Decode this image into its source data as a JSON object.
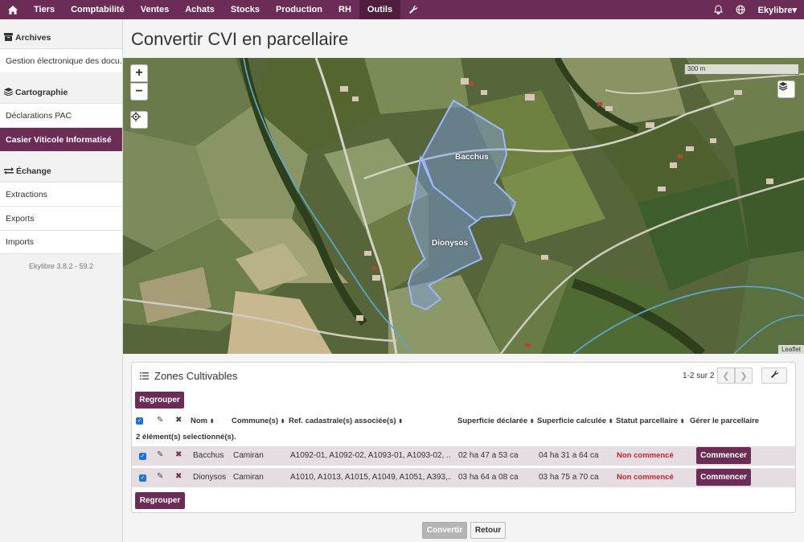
{
  "topbar": {
    "home_icon": "home-icon",
    "items": [
      "Tiers",
      "Comptabilité",
      "Ventes",
      "Achats",
      "Stocks",
      "Production",
      "RH",
      "Outils"
    ],
    "active": "Outils",
    "wrench_icon": "wrench-icon",
    "bell_icon": "bell-icon",
    "globe_icon": "globe-icon",
    "user_label": "Ekylibre▾"
  },
  "sidebar": {
    "sections": [
      {
        "title": "Archives",
        "icon": "archive-icon",
        "items": [
          "Gestion électronique des docu..."
        ]
      },
      {
        "title": "Cartographie",
        "icon": "layers-icon",
        "items": [
          "Déclarations PAC",
          "Casier Viticole Informatisé"
        ]
      },
      {
        "title": "Échange",
        "icon": "exchange-icon",
        "items": [
          "Extractions",
          "Exports",
          "Imports"
        ]
      }
    ],
    "active_item": "Casier Viticole Informatisé",
    "version": "Ekylibre 3.8.2 - 59.2"
  },
  "page": {
    "title": "Convertir CVI en parcellaire"
  },
  "map": {
    "zoom_in": "+",
    "zoom_out": "−",
    "scale_label": "300 m",
    "attribution": "Leaflet",
    "parcel_labels": [
      "Bacchus",
      "Dionysos"
    ]
  },
  "panel": {
    "title": "Zones Cultivables",
    "list_icon": "list-icon",
    "pagination": "1-2 sur 2",
    "regroup_label": "Regrouper",
    "selected_count": "2 élément(s) selectionné(s).",
    "columns": [
      "Nom",
      "Commune(s)",
      "Ref. cadastrale(s) associée(s)",
      "Superficie déclarée",
      "Superficie calculée",
      "Statut parcellaire",
      "Gérer le parcellaire"
    ],
    "sort_icon": "sort-icon",
    "rows": [
      {
        "name": "Bacchus",
        "commune": "Camiran",
        "refs": "A1092-01, A1092-02, A1093-01, A1093-02, ...",
        "declared": "02 ha 47 a 53 ca",
        "computed": "04 ha 31 a 64 ca",
        "status": "Non commencé",
        "action": "Commencer"
      },
      {
        "name": "Dionysos",
        "commune": "Camiran",
        "refs": "A1010, A1013, A1015, A1049, A1051, A393,...",
        "declared": "03 ha 64 a 08 ca",
        "computed": "03 ha 75 a 70 ca",
        "status": "Non commencé",
        "action": "Commencer"
      }
    ]
  },
  "footer": {
    "convert_label": "Convertir",
    "back_label": "Retour"
  },
  "colors": {
    "brand": "#6b2c55",
    "status_red": "#c4232d",
    "checkbox_blue": "#1e73d8",
    "parcel_blue": "#7a9ee8"
  }
}
